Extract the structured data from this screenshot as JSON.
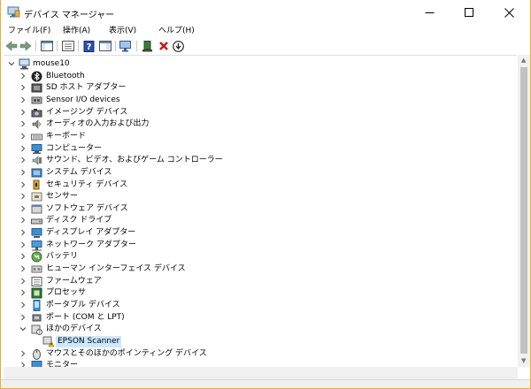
{
  "window": {
    "title": "デバイス マネージャー"
  },
  "menu": [
    {
      "label": "ファイル(F)"
    },
    {
      "label": "操作(A)"
    },
    {
      "label": "表示(V)"
    },
    {
      "label": "ヘルプ(H)"
    }
  ],
  "tree": {
    "root": "mouse10",
    "items": [
      {
        "label": "Bluetooth",
        "icon": "bluetooth-icon",
        "expanded": false
      },
      {
        "label": "SD ホスト アダプター",
        "icon": "sd-host-icon",
        "expanded": false
      },
      {
        "label": "Sensor I/O devices",
        "icon": "sensor-io-icon",
        "expanded": false
      },
      {
        "label": "イメージング デバイス",
        "icon": "camera-icon",
        "expanded": false
      },
      {
        "label": "オーディオの入力および出力",
        "icon": "speaker-icon",
        "expanded": false
      },
      {
        "label": "キーボード",
        "icon": "keyboard-icon",
        "expanded": false
      },
      {
        "label": "コンピューター",
        "icon": "computer-icon",
        "expanded": false
      },
      {
        "label": "サウンド、ビデオ、およびゲーム コントローラー",
        "icon": "sound-icon",
        "expanded": false
      },
      {
        "label": "システム デバイス",
        "icon": "system-icon",
        "expanded": false
      },
      {
        "label": "セキュリティ デバイス",
        "icon": "security-icon",
        "expanded": false
      },
      {
        "label": "センサー",
        "icon": "sensor-icon",
        "expanded": false
      },
      {
        "label": "ソフトウェア デバイス",
        "icon": "software-icon",
        "expanded": false
      },
      {
        "label": "ディスク ドライブ",
        "icon": "disk-icon",
        "expanded": false
      },
      {
        "label": "ディスプレイ アダプター",
        "icon": "display-icon",
        "expanded": false
      },
      {
        "label": "ネットワーク アダプター",
        "icon": "network-icon",
        "expanded": false
      },
      {
        "label": "バッテリ",
        "icon": "battery-icon",
        "expanded": false
      },
      {
        "label": "ヒューマン インターフェイス デバイス",
        "icon": "hid-icon",
        "expanded": false
      },
      {
        "label": "ファームウェア",
        "icon": "firmware-icon",
        "expanded": false
      },
      {
        "label": "プロセッサ",
        "icon": "processor-icon",
        "expanded": false
      },
      {
        "label": "ポータブル デバイス",
        "icon": "portable-icon",
        "expanded": false
      },
      {
        "label": "ポート (COM と LPT)",
        "icon": "port-icon",
        "expanded": false
      },
      {
        "label": "ほかのデバイス",
        "icon": "unknown-device-icon",
        "expanded": true,
        "children": [
          {
            "label": "EPSON Scanner",
            "icon": "warning-device-icon",
            "selected": true
          }
        ]
      },
      {
        "label": "マウスとそのほかのポインティング デバイス",
        "icon": "mouse-icon",
        "expanded": false
      },
      {
        "label": "モニター",
        "icon": "monitor-icon",
        "expanded": false
      }
    ]
  }
}
